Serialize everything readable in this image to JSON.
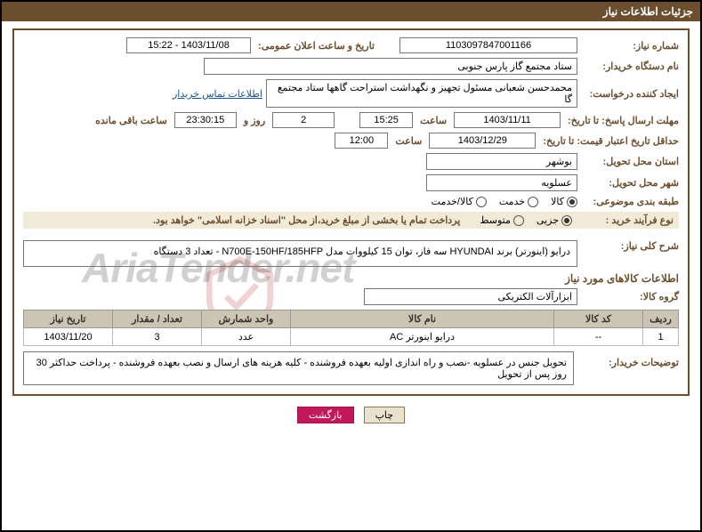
{
  "header": {
    "title": "جزئیات اطلاعات نیاز"
  },
  "fields": {
    "needNumber_label": "شماره نیاز:",
    "needNumber": "1103097847001166",
    "announceDateTime_label": "تاریخ و ساعت اعلان عمومی:",
    "announceDateTime": "1403/11/08 - 15:22",
    "buyerOrg_label": "نام دستگاه خریدار:",
    "buyerOrg": "ستاد مجتمع گاز پارس جنوبی",
    "requester_label": "ایجاد کننده درخواست:",
    "requester": "محمدحسن شعبانی مسئول تجهیز و نگهداشت استراحت گاهها ستاد مجتمع گا",
    "contactLink": "اطلاعات تماس خریدار",
    "deadlineSend_label": "مهلت ارسال پاسخ: تا تاریخ:",
    "deadlineSend_date": "1403/11/11",
    "deadlineSend_time": "15:25",
    "saat": "ساعت",
    "remain_days": "2",
    "rooz_va": "روز و",
    "remain_time": "23:30:15",
    "remain_label": "ساعت باقی مانده",
    "validity_label": "حداقل تاریخ اعتبار قیمت: تا تاریخ:",
    "validity_date": "1403/12/29",
    "validity_time": "12:00",
    "province_label": "استان محل تحویل:",
    "province": "بوشهر",
    "city_label": "شهر محل تحویل:",
    "city": "عسلویه",
    "category_label": "طبقه بندی موضوعی:",
    "cat_goods": "کالا",
    "cat_service": "خدمت",
    "cat_goods_service": "کالا/خدمت",
    "process_label": "نوع فرآیند خرید :",
    "proc_partial": "جزیی",
    "proc_medium": "متوسط",
    "paymentNote": "پرداخت تمام یا بخشی از مبلغ خرید،از محل \"اسناد خزانه اسلامی\" خواهد بود.",
    "overallDesc_label": "شرح کلی نیاز:",
    "overallDesc": "درایو (اینورتر) برند HYUNDAI سه فاز، توان 15 کیلووات مدل  N700E-150HF/185HFP - تعداد 3 دستگاه",
    "itemsSection": "اطلاعات کالاهای مورد نیاز",
    "group_label": "گروه کالا:",
    "group": "ابزارآلات الکتریکی",
    "buyerNotes_label": "توضیحات خریدار:",
    "buyerNotes": "تحویل جنس در عسلویه -نصب و راه اندازی اولیه بعهده فروشنده - کلیه هزینه های ارسال و نصب بعهده فروشنده - پرداخت حداکثر 30 روز پس از تحویل"
  },
  "table": {
    "headers": {
      "row": "ردیف",
      "code": "کد کالا",
      "name": "نام کالا",
      "unit": "واحد شمارش",
      "qty": "تعداد / مقدار",
      "needDate": "تاریخ نیاز"
    },
    "rows": [
      {
        "row": "1",
        "code": "--",
        "name": "درایو اینورتر AC",
        "unit": "عدد",
        "qty": "3",
        "needDate": "1403/11/20"
      }
    ]
  },
  "buttons": {
    "print": "چاپ",
    "back": "بازگشت"
  },
  "watermark": "AriaTender.net"
}
